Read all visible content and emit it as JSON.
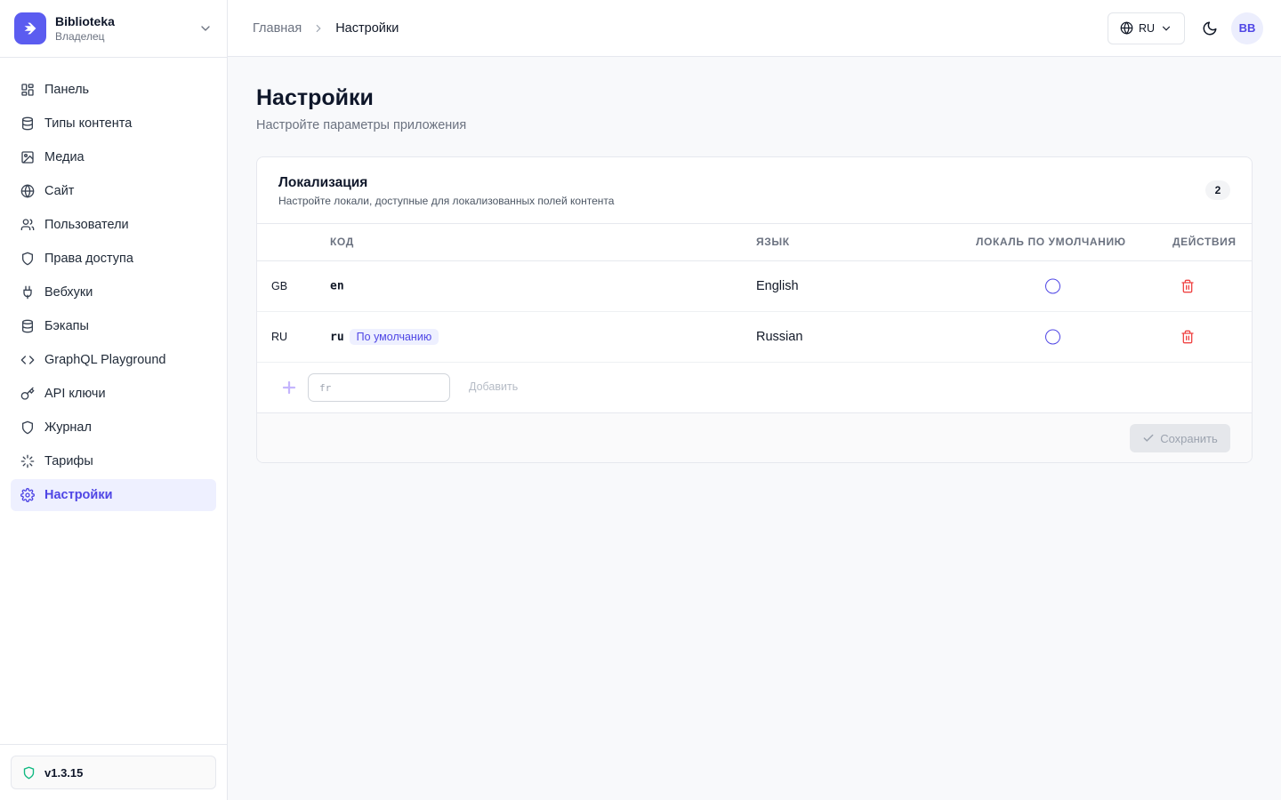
{
  "brand": {
    "name": "Biblioteka",
    "role": "Владелец"
  },
  "nav": [
    {
      "label": "Панель",
      "icon": "dashboard-icon",
      "active": false
    },
    {
      "label": "Типы контента",
      "icon": "database-icon",
      "active": false
    },
    {
      "label": "Медиа",
      "icon": "image-icon",
      "active": false
    },
    {
      "label": "Сайт",
      "icon": "globe-icon",
      "active": false
    },
    {
      "label": "Пользователи",
      "icon": "users-icon",
      "active": false
    },
    {
      "label": "Права доступа",
      "icon": "shield-icon",
      "active": false
    },
    {
      "label": "Вебхуки",
      "icon": "plug-icon",
      "active": false
    },
    {
      "label": "Бэкапы",
      "icon": "database-icon",
      "active": false
    },
    {
      "label": "GraphQL Playground",
      "icon": "code-icon",
      "active": false
    },
    {
      "label": "API ключи",
      "icon": "key-icon",
      "active": false
    },
    {
      "label": "Журнал",
      "icon": "shield-icon",
      "active": false
    },
    {
      "label": "Тарифы",
      "icon": "loader-icon",
      "active": false
    },
    {
      "label": "Настройки",
      "icon": "gear-icon",
      "active": true
    }
  ],
  "version": "v1.3.15",
  "header": {
    "breadcrumb": [
      "Главная",
      "Настройки"
    ],
    "language": "RU",
    "avatar_initials": "BB"
  },
  "page": {
    "title": "Настройки",
    "subtitle": "Настройте параметры приложения"
  },
  "localization": {
    "title": "Локализация",
    "description": "Настройте локали, доступные для локализованных полей контента",
    "count": "2",
    "columns": {
      "code": "КОД",
      "language": "ЯЗЫК",
      "default": "ЛОКАЛЬ ПО УМОЛЧАНИЮ",
      "actions": "ДЕЙСТВИЯ"
    },
    "rows": [
      {
        "flag": "GB",
        "code": "en",
        "language": "English",
        "is_default": false
      },
      {
        "flag": "RU",
        "code": "ru",
        "language": "Russian",
        "is_default": true,
        "default_badge": "По умолчанию"
      }
    ],
    "add": {
      "placeholder": "fr",
      "button": "Добавить"
    },
    "save_label": "Сохранить"
  },
  "colors": {
    "accent": "#4f46e5",
    "brand": "#5b5cf0",
    "danger": "#ef4444",
    "version_icon": "#10b981"
  }
}
